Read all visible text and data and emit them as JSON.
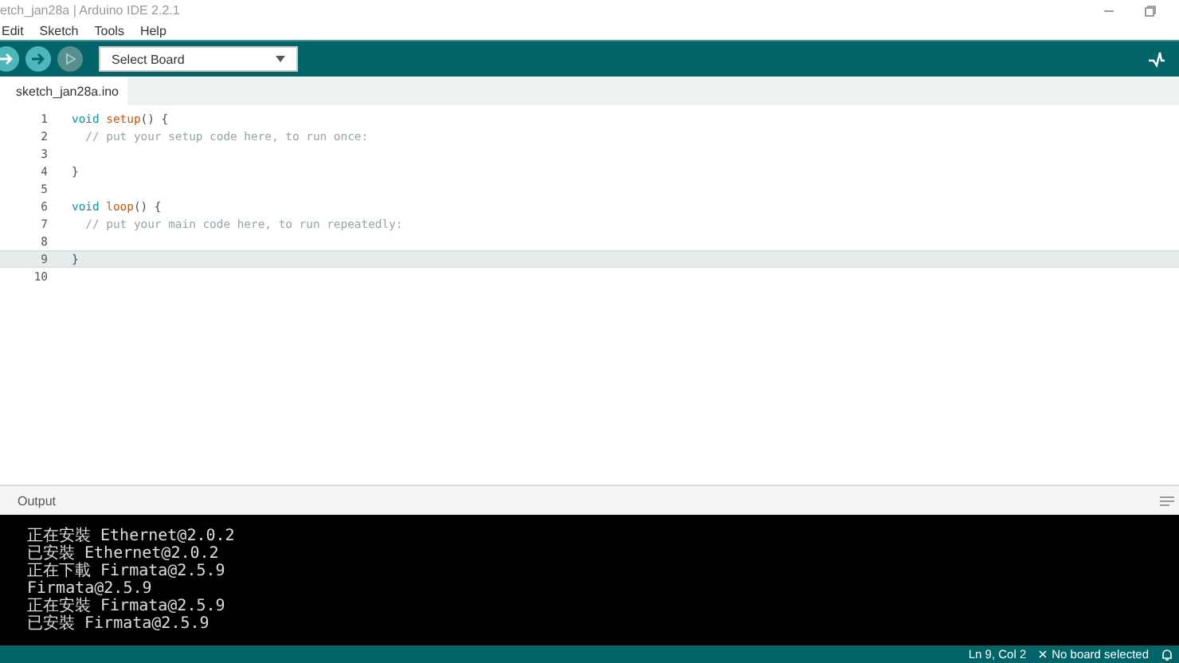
{
  "window": {
    "title": "etch_jan28a | Arduino IDE 2.2.1"
  },
  "menu": [
    "Edit",
    "Sketch",
    "Tools",
    "Help"
  ],
  "toolbar": {
    "board_select": "Select Board"
  },
  "tabs": [
    {
      "label": "sketch_jan28a.ino",
      "selected": true
    }
  ],
  "editor": {
    "lines": [
      {
        "number": "1",
        "current": false,
        "tokens": [
          {
            "kind": "keyword",
            "text": "void "
          },
          {
            "kind": "function",
            "text": "setup"
          },
          {
            "kind": "plain",
            "text": "() {"
          }
        ]
      },
      {
        "number": "2",
        "current": false,
        "tokens": [
          {
            "kind": "comment",
            "text": "  // put your setup code here, to run once:"
          }
        ]
      },
      {
        "number": "3",
        "current": false
      },
      {
        "number": "4",
        "current": false,
        "tokens": [
          {
            "kind": "plain",
            "text": "}"
          }
        ]
      },
      {
        "number": "5",
        "current": false
      },
      {
        "number": "6",
        "current": false,
        "tokens": [
          {
            "kind": "keyword",
            "text": "void "
          },
          {
            "kind": "function",
            "text": "loop"
          },
          {
            "kind": "plain",
            "text": "() {"
          }
        ]
      },
      {
        "number": "7",
        "current": false,
        "tokens": [
          {
            "kind": "comment",
            "text": "  // put your main code here, to run repeatedly:"
          }
        ]
      },
      {
        "number": "8",
        "current": false
      },
      {
        "number": "9",
        "current": true,
        "tokens": [
          {
            "kind": "plain",
            "text": "}"
          }
        ]
      },
      {
        "number": "10",
        "current": false
      }
    ]
  },
  "output": {
    "title": "Output",
    "lines": [
      "正在安裝 Ethernet@2.0.2",
      "已安裝 Ethernet@2.0.2",
      "正在下載 Firmata@2.5.9",
      "Firmata@2.5.9",
      "正在安裝 Firmata@2.5.9",
      "已安裝 Firmata@2.5.9"
    ]
  },
  "status_bar": {
    "position": "Ln 9, Col 2",
    "board": "No board selected"
  }
}
